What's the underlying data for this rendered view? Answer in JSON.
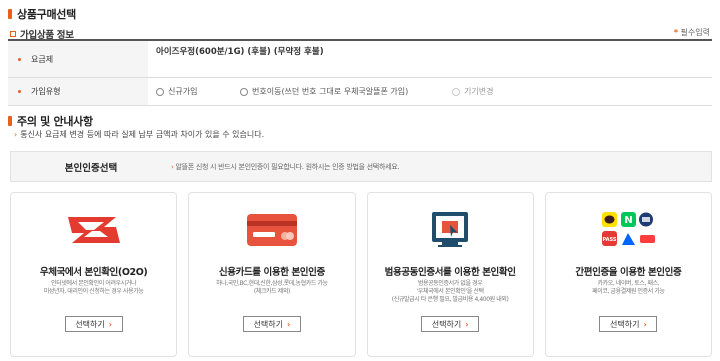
{
  "section1": {
    "title": "상품구매선택"
  },
  "subscription": {
    "title": "가입상품 정보",
    "required_mark": "*",
    "required_label": "필수입력",
    "plan_label": "요금제",
    "plan_value": "아이즈우정(600분/1G) (후불) (무약정 후불)",
    "type_label": "가입유형",
    "options": [
      "신규가입",
      "번호이동(쓰던 번호 그대로 우체국알뜰폰 가입)",
      "기기변경"
    ]
  },
  "section2": {
    "title": "주의 및 안내사항",
    "notice": "통신사 요금제 변경 등에 따라 실제 납부 금액과 차이가 있을 수 있습니다."
  },
  "auth": {
    "label": "본인인증선택",
    "desc": "알뜰폰 신청 시 반드시 본인인증이 필요합니다. 원하시는 인증 방법을 선택하세요."
  },
  "cards": [
    {
      "icon": "epost-logo-icon",
      "title": "우체국에서 본인확인(O2O)",
      "desc": "인터넷에서 본인확인이 어려우시거나\n미성년자, 대리인이 신청하는 경우 사용가능",
      "button": "선택하기"
    },
    {
      "icon": "credit-card-icon",
      "title": "신용카드를 이용한 본인인증",
      "desc": "하나,국민,BC,현대,신한,삼성,롯데,농협카드 가능\n(체크카드 제외)",
      "button": "선택하기"
    },
    {
      "icon": "certificate-icon",
      "title": "범용공동인증서를 이용한 본인확인",
      "desc": "범용공동인증서가 없을 경우\n'우체국에서 본인확인'을 선택\n(신규발급시 타 은행 필요, 발급비용 4,400원 내외)",
      "button": "선택하기"
    },
    {
      "icon": "simple-auth-apps-icon",
      "title": "간편인증을 이용한 본인인증",
      "desc": "카카오, 네이버, 토스, 패스,\n페이코, 금융결제원 인증서 가능",
      "button": "선택하기"
    }
  ],
  "colors": {
    "accent": "#e8601c",
    "red": "#e33b2f"
  }
}
